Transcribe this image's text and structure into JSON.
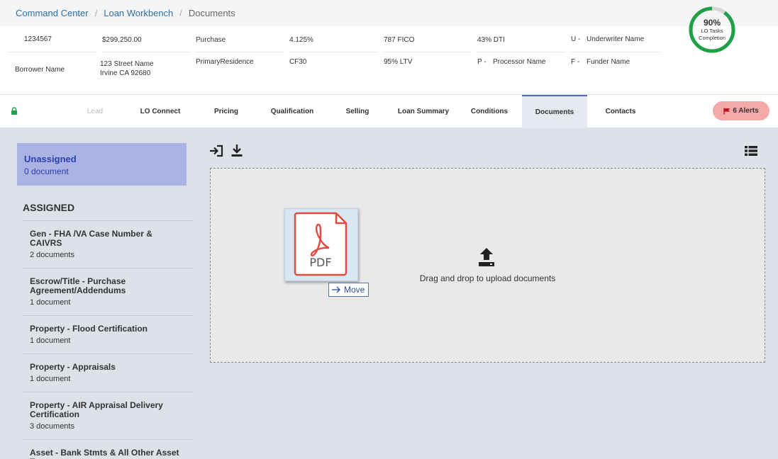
{
  "breadcrumb": {
    "items": [
      "Command Center",
      "Loan Workbench"
    ],
    "current": "Documents",
    "separator": "/"
  },
  "loan": {
    "loan_number": "1234567",
    "amount": "$299,250.00",
    "purpose": "Purchase",
    "rate": "4.125%",
    "fico": "787 FICO",
    "dti": "43% DTI",
    "borrower": "Borrower Name",
    "address_line1": "123 Street Name",
    "address_line2": "Irvine CA 92680",
    "occupancy": "PrimaryResidence",
    "program": "CF30",
    "ltv": "95% LTV",
    "underwriter": {
      "prefix": "U -",
      "name": "Underwriter Name"
    },
    "processor": {
      "prefix": "P -",
      "name": "Processor Name"
    },
    "funder": {
      "prefix": "F -",
      "name": "Funder Name"
    }
  },
  "progress": {
    "value": 0.9,
    "percent_label": "90%",
    "label": "LO Tasks Completion",
    "color": "#1fa048",
    "track_color": "#d5d5d5"
  },
  "tabs": [
    {
      "label": "Lead"
    },
    {
      "label": "LO Connect"
    },
    {
      "label": "Pricing"
    },
    {
      "label": "Qualification"
    },
    {
      "label": "Selling"
    },
    {
      "label": "Loan Summary"
    },
    {
      "label": "Conditions"
    },
    {
      "label": "Documents"
    },
    {
      "label": "Contacts"
    }
  ],
  "alerts": {
    "label": "6 Alerts",
    "icon": "flag-icon"
  },
  "unassigned": {
    "title": "Unassigned",
    "count": "0 document"
  },
  "assigned": {
    "heading": "ASSIGNED",
    "items": [
      {
        "title": "Gen - FHA /VA Case Number & CAIVRS",
        "count": "2 documents"
      },
      {
        "title": "Escrow/Title - Purchase Agreement/Addendums",
        "count": "1 document"
      },
      {
        "title": "Property - Flood Certification",
        "count": "1 document"
      },
      {
        "title": "Property - Appraisals",
        "count": "1 document"
      },
      {
        "title": "Property - AIR Appraisal Delivery Certification",
        "count": "3 documents"
      },
      {
        "title": "Asset - Bank Stmts & All Other Asset Types",
        "count": ""
      }
    ]
  },
  "dropzone": {
    "text": "Drag and drop to upload documents"
  },
  "drag": {
    "file_label": "PDF",
    "action": "Move"
  },
  "colors": {
    "accent": "#2b3fb0",
    "pdf_red": "#e04a3f",
    "alert_bg": "#f5a8a8"
  }
}
